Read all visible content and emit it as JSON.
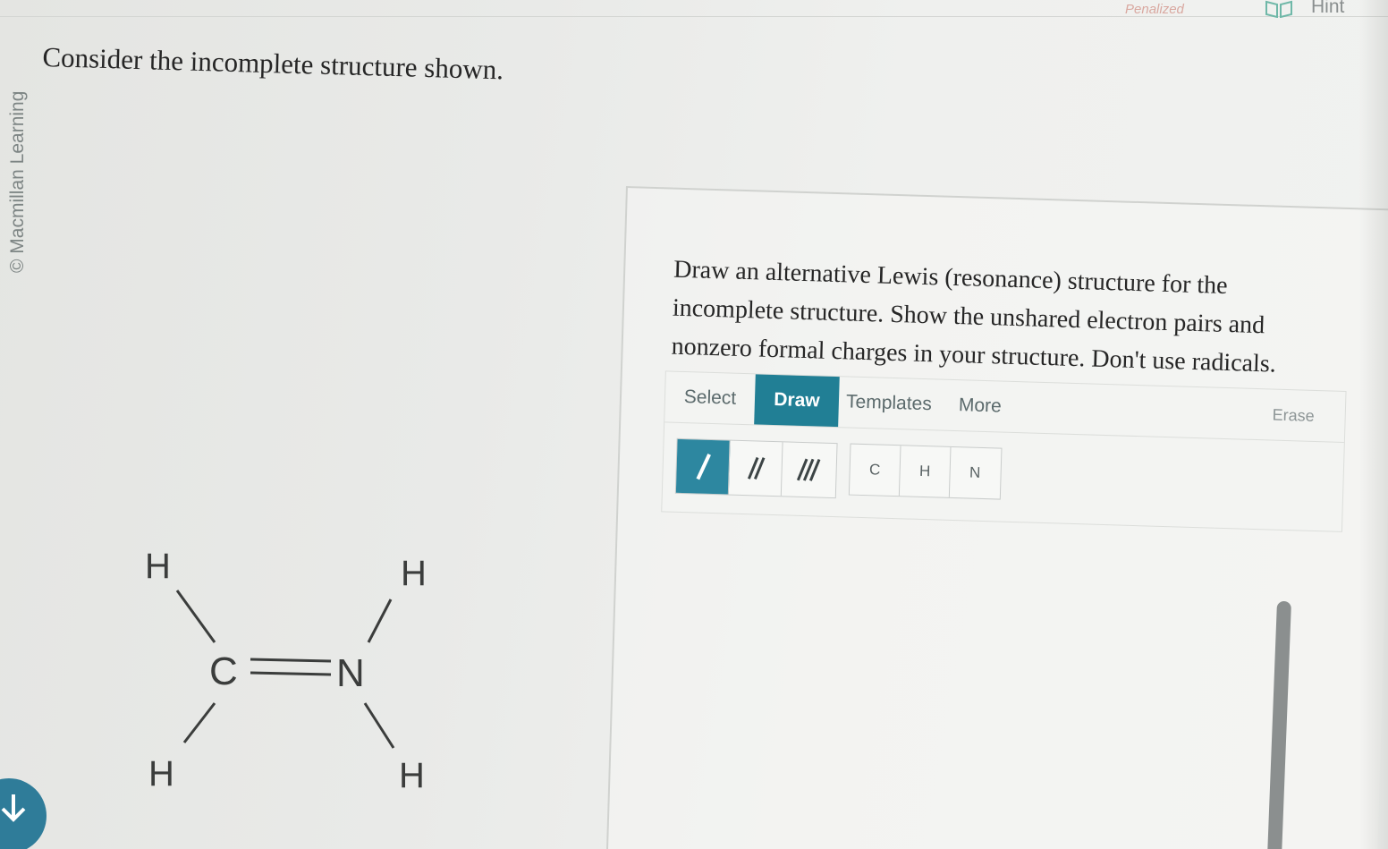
{
  "header": {
    "status_text": "Penalized",
    "hint_label": "Hint"
  },
  "copyright": "© Macmillan Learning",
  "question": {
    "text": "Consider the incomplete structure shown."
  },
  "molecule": {
    "atoms": {
      "h_top_left": "H",
      "h_top_right": "H",
      "carbon": "C",
      "nitrogen": "N",
      "h_bottom_left": "H",
      "h_bottom_right": "H"
    }
  },
  "instructions": {
    "text": "Draw an alternative Lewis (resonance) structure for the incomplete structure. Show the unshared electron pairs and nonzero formal charges in your structure. Don't use radicals."
  },
  "editor": {
    "tabs": [
      {
        "label": "Select",
        "active": false
      },
      {
        "label": "Draw",
        "active": true
      },
      {
        "label": "Templates",
        "active": false
      },
      {
        "label": "More",
        "active": false
      }
    ],
    "erase_label": "Erase",
    "bond_tools": [
      {
        "icon": "single-bond-icon",
        "active": true
      },
      {
        "icon": "double-bond-icon",
        "active": false
      },
      {
        "icon": "triple-bond-icon",
        "active": false
      }
    ],
    "atom_tools": [
      "C",
      "H",
      "N"
    ]
  },
  "colors": {
    "accent": "#217f95",
    "penalized": "#d9a8a0",
    "text": "#262626"
  }
}
